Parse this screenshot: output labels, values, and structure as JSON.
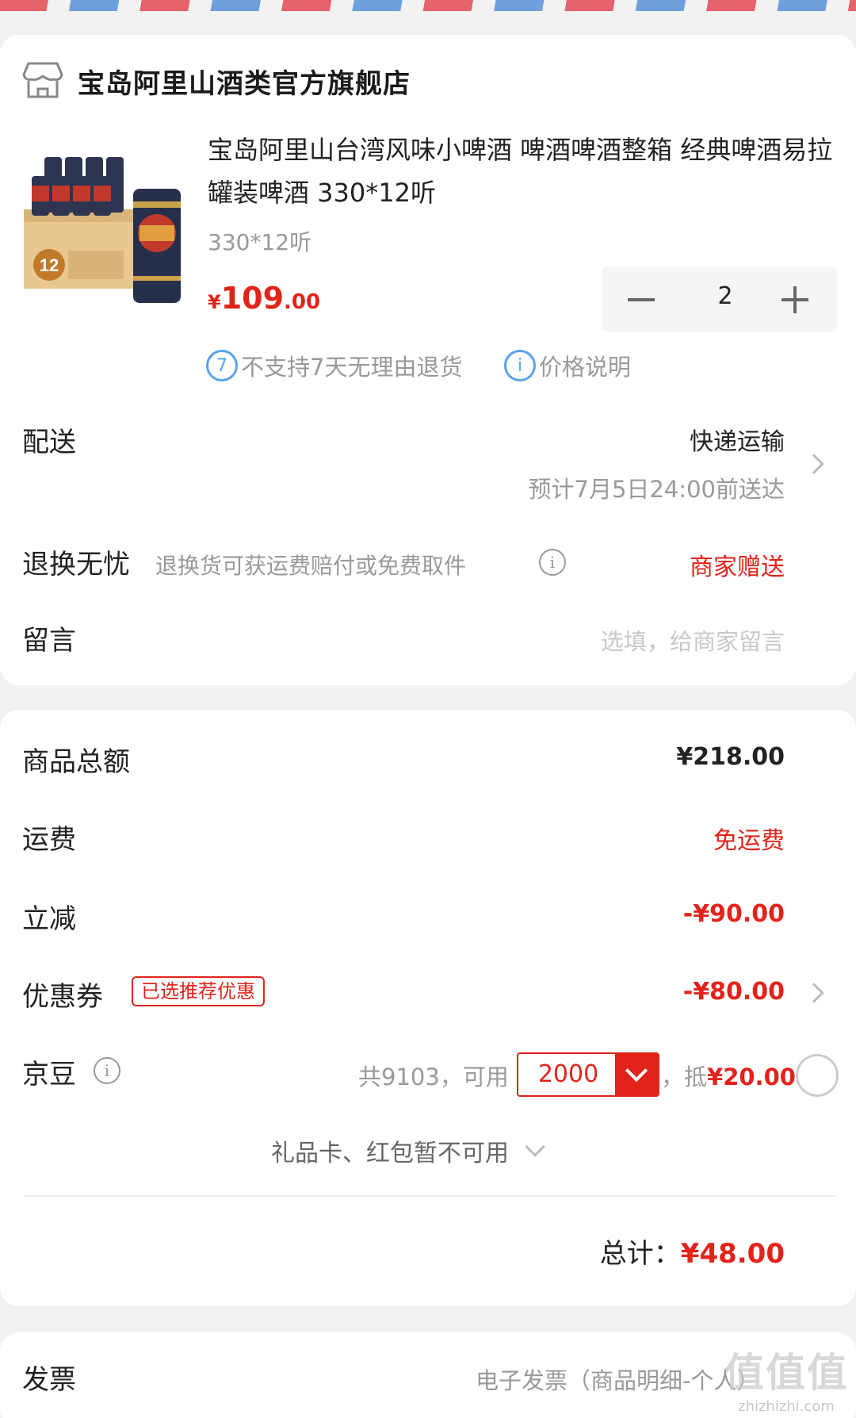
{
  "store": {
    "icon": "store-icon",
    "name": "宝岛阿里山酒类官方旗舰店"
  },
  "product": {
    "image_icon": "beer-can-box-image",
    "title": "宝岛阿里山台湾风味小啤酒 啤酒啤酒整箱 经典啤酒易拉罐装啤酒 330*12听",
    "spec": "330*12听",
    "price_currency": "¥",
    "price_int": "109",
    "price_dec": ".00",
    "quantity": "2",
    "notice_no_return": "不支持7天无理由退货",
    "notice_price_info": "价格说明",
    "brand_colors": {
      "price": "#e2231a",
      "notice_icon": "#5aa3e8"
    }
  },
  "delivery": {
    "label": "配送",
    "method": "快递运输",
    "eta": "预计7月5日24:00前送达"
  },
  "returns": {
    "label": "退换无忧",
    "desc": "退换货可获运费赔付或免费取件",
    "value": "商家赠送"
  },
  "message": {
    "label": "留言",
    "placeholder": "选填，给商家留言"
  },
  "summary": {
    "goods_total_label": "商品总额",
    "goods_total": "¥218.00",
    "shipping_label": "运费",
    "shipping_value": "免运费",
    "discount_label": "立减",
    "discount_value": "-¥90.00",
    "coupon_label": "优惠券",
    "coupon_badge": "已选推荐优惠",
    "coupon_value": "-¥80.00",
    "beans_label": "京豆",
    "beans_text": "共9103，可用",
    "beans_select": "2000",
    "beans_deduct_prefix": "，抵",
    "beans_deduct_value": "¥20.00",
    "giftcard_text": "礼品卡、红包暂不可用",
    "total_label": "总计：",
    "total_value": "¥48.00"
  },
  "invoice": {
    "label": "发票",
    "value": "电子发票（商品明细-个人）"
  },
  "watermark": {
    "big": "值值值",
    "small": "zhizhizhi.com"
  }
}
